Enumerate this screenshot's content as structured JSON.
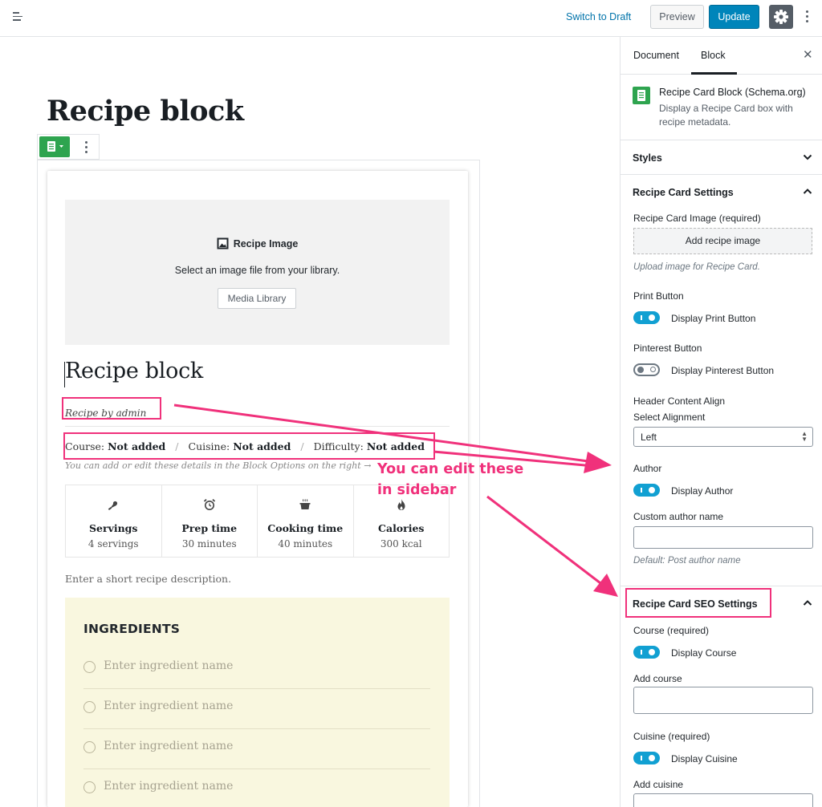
{
  "topbar": {
    "switch_to_draft": "Switch to Draft",
    "preview": "Preview",
    "update": "Update"
  },
  "editor": {
    "post_title": "Recipe block",
    "recipe_card": {
      "image_placeholder": {
        "title": "Recipe Image",
        "description": "Select an image file from your library.",
        "button": "Media Library"
      },
      "title": "Recipe block",
      "byline": "Recipe by admin",
      "details": [
        {
          "label": "Course:",
          "value": "Not added"
        },
        {
          "label": "Cuisine:",
          "value": "Not added"
        },
        {
          "label": "Difficulty:",
          "value": "Not added"
        }
      ],
      "details_separator": "/",
      "hint": "You can add or edit these details in the Block Options on the right →",
      "stats": [
        {
          "icon": "servings-icon",
          "label": "Servings",
          "value": "4 servings"
        },
        {
          "icon": "alarm-clock-icon",
          "label": "Prep time",
          "value": "30 minutes"
        },
        {
          "icon": "cooking-pot-icon",
          "label": "Cooking time",
          "value": "40 minutes"
        },
        {
          "icon": "flame-icon",
          "label": "Calories",
          "value": "300 kcal"
        }
      ],
      "summary_placeholder": "Enter a short recipe description.",
      "ingredients": {
        "title": "INGREDIENTS",
        "placeholder": "Enter ingredient name",
        "items": [
          "Enter ingredient name",
          "Enter ingredient name",
          "Enter ingredient name",
          "Enter ingredient name"
        ]
      }
    }
  },
  "sidebar": {
    "tabs": [
      {
        "label": "Document"
      },
      {
        "label": "Block",
        "active": true
      }
    ],
    "block_info": {
      "title": "Recipe Card Block (Schema.org)",
      "description": "Display a Recipe Card box with recipe metadata."
    },
    "styles_panel": "Styles",
    "settings_panel": {
      "title": "Recipe Card Settings",
      "image_label": "Recipe Card Image (required)",
      "add_image_button": "Add recipe image",
      "image_help": "Upload image for Recipe Card.",
      "print_label": "Print Button",
      "print_toggle": {
        "label": "Display Print Button",
        "on": true
      },
      "pinterest_label": "Pinterest Button",
      "pinterest_toggle": {
        "label": "Display Pinterest Button",
        "on": false
      },
      "align_label": "Header Content Align",
      "select_alignment_label": "Select Alignment",
      "alignment_value": "Left",
      "author_label": "Author",
      "author_toggle": {
        "label": "Display Author",
        "on": true
      },
      "custom_author_label": "Custom author name",
      "custom_author_value": "",
      "author_help": "Default: Post author name"
    },
    "seo_panel": {
      "title": "Recipe Card SEO Settings",
      "course_label": "Course (required)",
      "course_toggle": {
        "label": "Display Course",
        "on": true
      },
      "add_course_label": "Add course",
      "add_course_value": "",
      "cuisine_label": "Cuisine (required)",
      "cuisine_toggle": {
        "label": "Display Cuisine",
        "on": true
      },
      "add_cuisine_label": "Add cuisine"
    }
  },
  "annotation": {
    "line1": "You can edit these",
    "line2": "in sidebar",
    "color": "#f0317b"
  },
  "colors": {
    "accent": "#0085ba",
    "link": "#0073aa",
    "toggle_on": "#11a0d2",
    "block_icon": "#2ea44f",
    "ingredients_bg": "#f9f7df"
  }
}
